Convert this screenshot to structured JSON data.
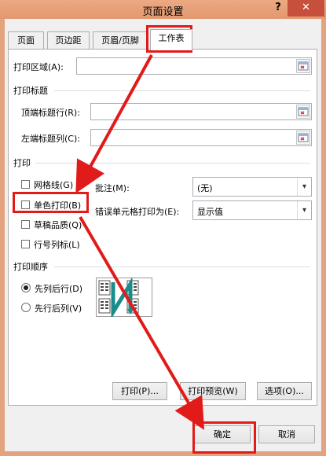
{
  "window": {
    "title": "页面设置",
    "help_label": "?",
    "close_label": "✕"
  },
  "tabs": [
    {
      "label": "页面",
      "active": false
    },
    {
      "label": "页边距",
      "active": false
    },
    {
      "label": "页眉/页脚",
      "active": false
    },
    {
      "label": "工作表",
      "active": true
    }
  ],
  "print_area": {
    "label": "打印区域(A):",
    "value": ""
  },
  "print_titles": {
    "heading": "打印标题",
    "rows_label": "顶端标题行(R):",
    "rows_value": "",
    "cols_label": "左端标题列(C):",
    "cols_value": ""
  },
  "print": {
    "heading": "打印",
    "gridlines": {
      "label": "网格线(G)",
      "checked": false
    },
    "black_white": {
      "label": "单色打印(B)",
      "checked": false
    },
    "draft": {
      "label": "草稿品质(Q)",
      "checked": false
    },
    "headings": {
      "label": "行号列标(L)",
      "checked": false
    },
    "comments_label": "批注(M):",
    "comments_value": "(无)",
    "errors_label": "错误单元格打印为(E):",
    "errors_value": "显示值"
  },
  "page_order": {
    "heading": "打印顺序",
    "down_then_over": {
      "label": "先列后行(D)",
      "selected": true
    },
    "over_then_down": {
      "label": "先行后列(V)",
      "selected": false
    }
  },
  "buttons": {
    "print": "打印(P)...",
    "preview": "打印预览(W)",
    "options": "选项(O)...",
    "ok": "确定",
    "cancel": "取消"
  },
  "colors": {
    "annotation_red": "#e11a1a",
    "title_bar": "#e7a07a",
    "close_button": "#c7503c"
  }
}
